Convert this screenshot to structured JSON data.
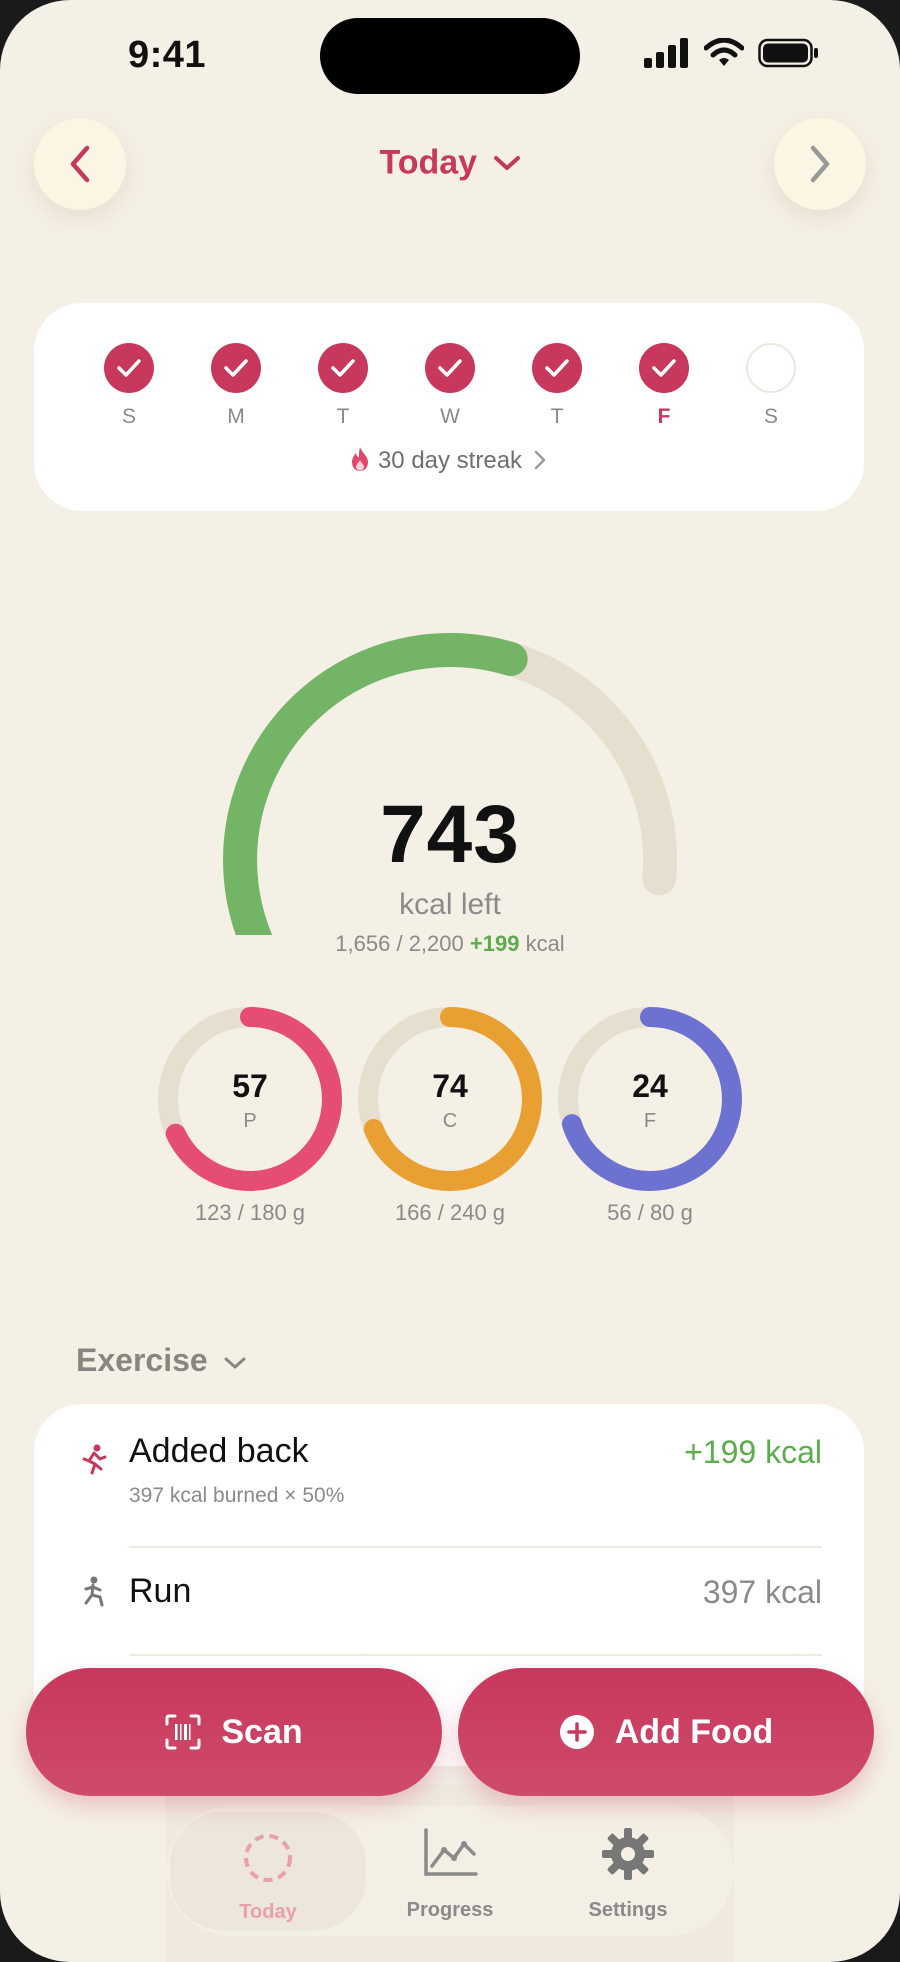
{
  "status": {
    "time": "9:41"
  },
  "header": {
    "title": "Today"
  },
  "streak": {
    "days": [
      {
        "label": "S",
        "done": true
      },
      {
        "label": "M",
        "done": true
      },
      {
        "label": "T",
        "done": true
      },
      {
        "label": "W",
        "done": true
      },
      {
        "label": "T",
        "done": true
      },
      {
        "label": "F",
        "done": true,
        "today": true
      },
      {
        "label": "S",
        "done": false
      }
    ],
    "text": "30 day streak"
  },
  "calories": {
    "left": "743",
    "left_label": "kcal left",
    "consumed": "1,656 / 2,200",
    "bonus": "+199",
    "unit": "kcal",
    "progress_fraction": 0.66
  },
  "macros": [
    {
      "value": "57",
      "label": "P",
      "grams": "123 / 180 g",
      "color": "#e54e72",
      "fraction": 0.68
    },
    {
      "value": "74",
      "label": "C",
      "grams": "166 / 240 g",
      "color": "#e9a032",
      "fraction": 0.69
    },
    {
      "value": "24",
      "label": "F",
      "grams": "56 / 80 g",
      "color": "#6d72d0",
      "fraction": 0.7
    }
  ],
  "exercise": {
    "section_label": "Exercise",
    "added_back": {
      "title": "Added back",
      "sub": "397 kcal burned × 50%",
      "value": "+199 kcal"
    },
    "run": {
      "title": "Run",
      "value": "397 kcal"
    }
  },
  "actions": {
    "scan": "Scan",
    "add_food": "Add Food"
  },
  "tabs": [
    {
      "label": "Today",
      "active": true
    },
    {
      "label": "Progress"
    },
    {
      "label": "Settings"
    }
  ],
  "colors": {
    "accent": "#c8385c",
    "positive": "#5cab4d",
    "background": "#f5f0e6"
  }
}
